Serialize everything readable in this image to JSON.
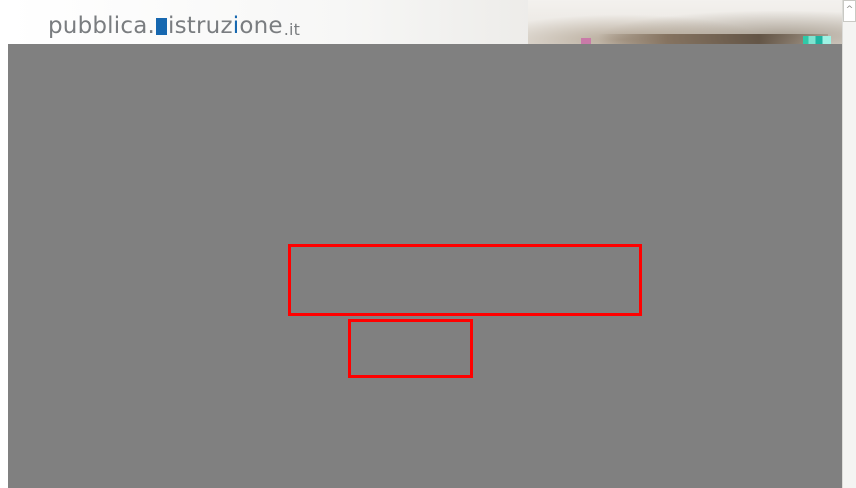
{
  "header": {
    "logo": {
      "part1": "pubblica.",
      "part2": "istruz",
      "accent_letter": "i",
      "part3": "one",
      "tld": ".it",
      "brand_color": "#1768b0",
      "text_color": "#7a7d80"
    }
  },
  "scrollbar": {
    "up_arrow_icon": "chevron-up-icon",
    "up_glyph": "^"
  },
  "overlay": {
    "color": "#808080"
  },
  "highlights": {
    "color": "#ff0000",
    "boxes": [
      "highlight-box-1",
      "highlight-box-2"
    ]
  }
}
